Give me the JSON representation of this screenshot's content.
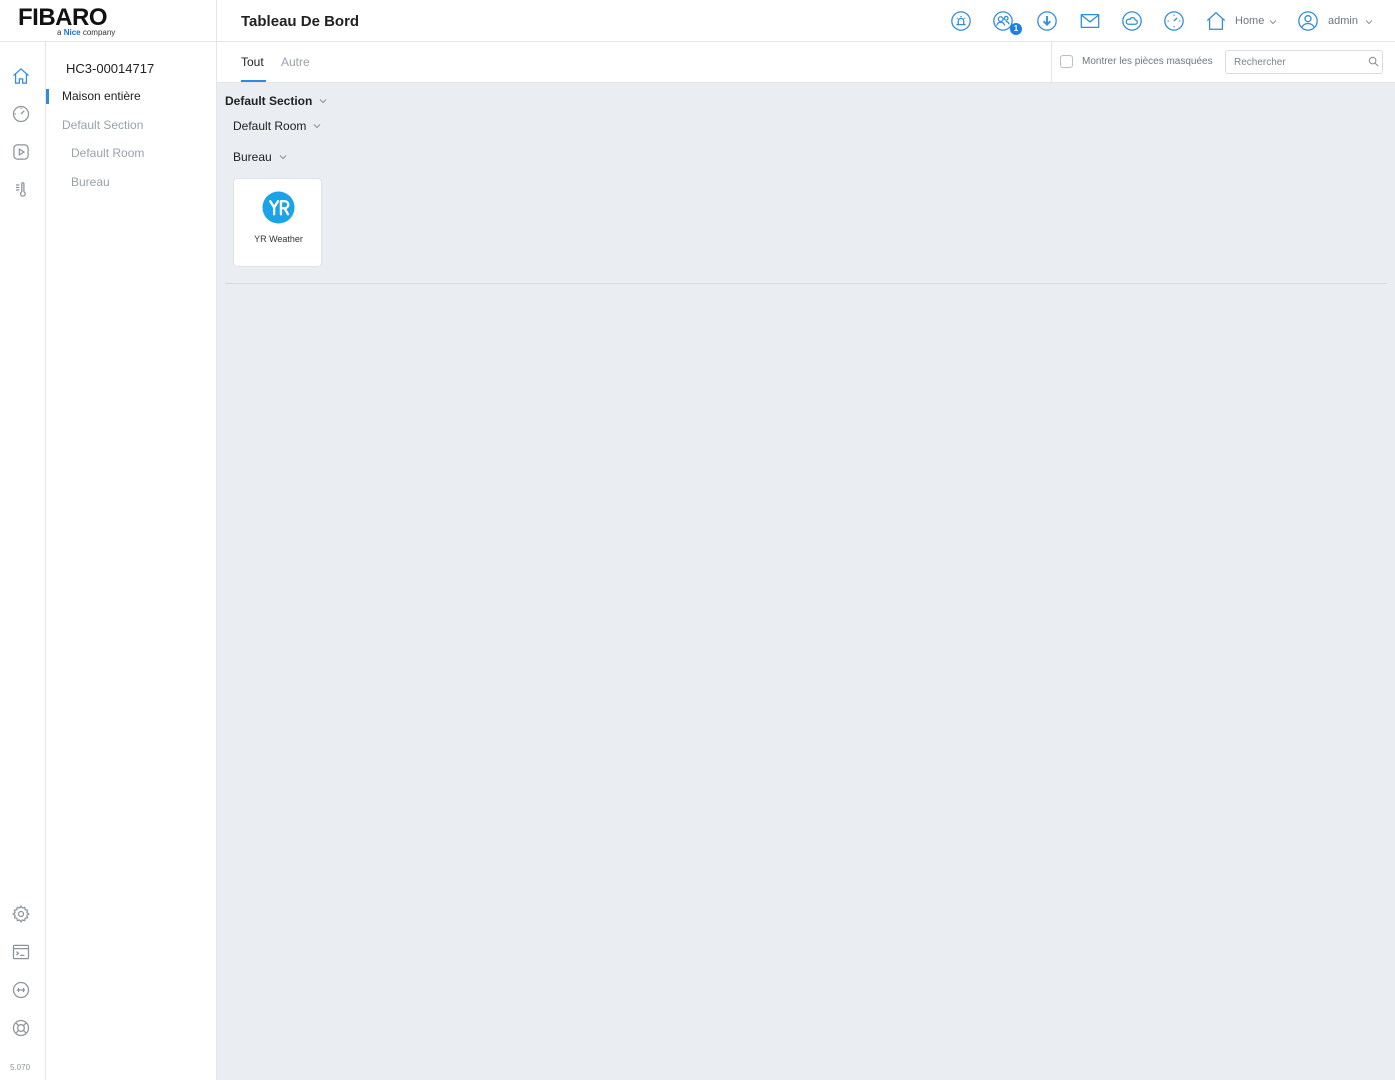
{
  "brand": {
    "name": "FIBARO",
    "tagline_prefix": "a",
    "tagline_brand": "Nice",
    "tagline_suffix": "company"
  },
  "header": {
    "title": "Tableau De Bord",
    "notifications_count": "1",
    "home_label": "Home",
    "user_label": "admin",
    "icons": [
      "alarm-icon",
      "users-icon",
      "download-icon",
      "mail-icon",
      "weather-icon",
      "clock-icon",
      "home-icon",
      "user-icon"
    ]
  },
  "rail": {
    "top_icons": [
      "home-icon",
      "scenes-icon",
      "play-icon",
      "climate-icon"
    ],
    "bottom_icons": [
      "settings-icon",
      "terminal-icon",
      "network-icon",
      "help-icon"
    ],
    "version": "5.070"
  },
  "sidenav": {
    "device_id": "HC3-00014717",
    "items": [
      {
        "label": "Maison entière",
        "active": true
      },
      {
        "label": "Default Section",
        "active": false
      },
      {
        "label": "Default Room",
        "active": false
      },
      {
        "label": "Bureau",
        "active": false
      }
    ]
  },
  "tabs": {
    "items": [
      {
        "label": "Tout",
        "active": true
      },
      {
        "label": "Autre",
        "active": false
      }
    ],
    "show_hidden_label": "Montrer les pièces masquées",
    "search_placeholder": "Rechercher"
  },
  "main": {
    "section_title": "Default Section",
    "rooms": [
      {
        "name": "Default Room"
      },
      {
        "name": "Bureau"
      }
    ],
    "devices": [
      {
        "name": "YR Weather",
        "room": "Bureau",
        "icon": "yr-weather-logo",
        "color": "#1aa3e8"
      }
    ]
  },
  "colors": {
    "accent": "#2f8be0",
    "background": "#eaedf2",
    "badge": "#1f7ee3"
  }
}
